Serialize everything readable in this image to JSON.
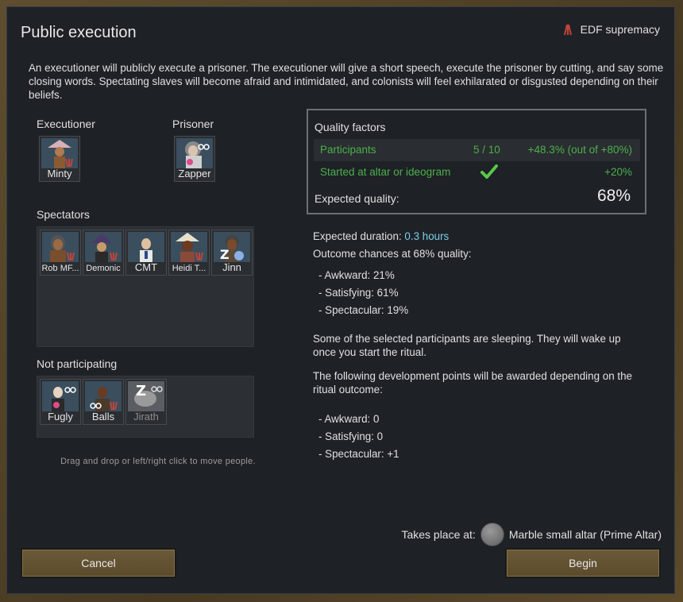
{
  "dialog": {
    "title": "Public execution",
    "ideoligion": "EDF supremacy",
    "description": "An executioner will publicly execute a prisoner. The executioner will give a short speech, execute the prisoner by cutting, and say some closing words. Spectating slaves will become afraid and intimidated, and colonists will feel exhilarated or disgusted depending on their beliefs."
  },
  "roles": {
    "executioner_label": "Executioner",
    "executioner_name": "Minty",
    "prisoner_label": "Prisoner",
    "prisoner_name": "Zapper"
  },
  "spectators": {
    "label": "Spectators",
    "pawns": [
      "Rob MF...",
      "Demonic",
      "CMT",
      "Heidi T...",
      "Jinn"
    ]
  },
  "not_participating": {
    "label": "Not participating",
    "pawns": [
      "Fugly",
      "Balls",
      "Jirath"
    ]
  },
  "hint": "Drag and drop or left/right click to move people.",
  "quality": {
    "title": "Quality factors",
    "participants_label": "Participants",
    "participants_count": "5 / 10",
    "participants_bonus": "+48.3% (out of +80%)",
    "altar_label": "Started at altar or ideogram",
    "altar_bonus": "+20%",
    "expected_label": "Expected quality:",
    "expected_value": "68%"
  },
  "outcome": {
    "duration_label": "Expected duration:",
    "duration_value": "0.3 hours",
    "chances_label": "Outcome chances at 68% quality:",
    "awkward": "- Awkward: 21%",
    "satisfying": "- Satisfying: 61%",
    "spectacular": "- Spectacular: 19%",
    "sleeping_note": "Some of the selected participants are sleeping. They will wake up once you start the ritual.",
    "dev_points_note": "The following development points will be awarded depending on the ritual outcome:",
    "dev_awkward": "- Awkward: 0",
    "dev_satisfying": "- Satisfying: 0",
    "dev_spectacular": "- Spectacular: +1"
  },
  "altar": {
    "label": "Takes place at:",
    "name": "Marble small altar (Prime Altar)"
  },
  "buttons": {
    "cancel": "Cancel",
    "begin": "Begin"
  },
  "colors": {
    "positive": "#4cb04c",
    "highlight": "#7ccfe8",
    "button": "#6b5a39"
  }
}
